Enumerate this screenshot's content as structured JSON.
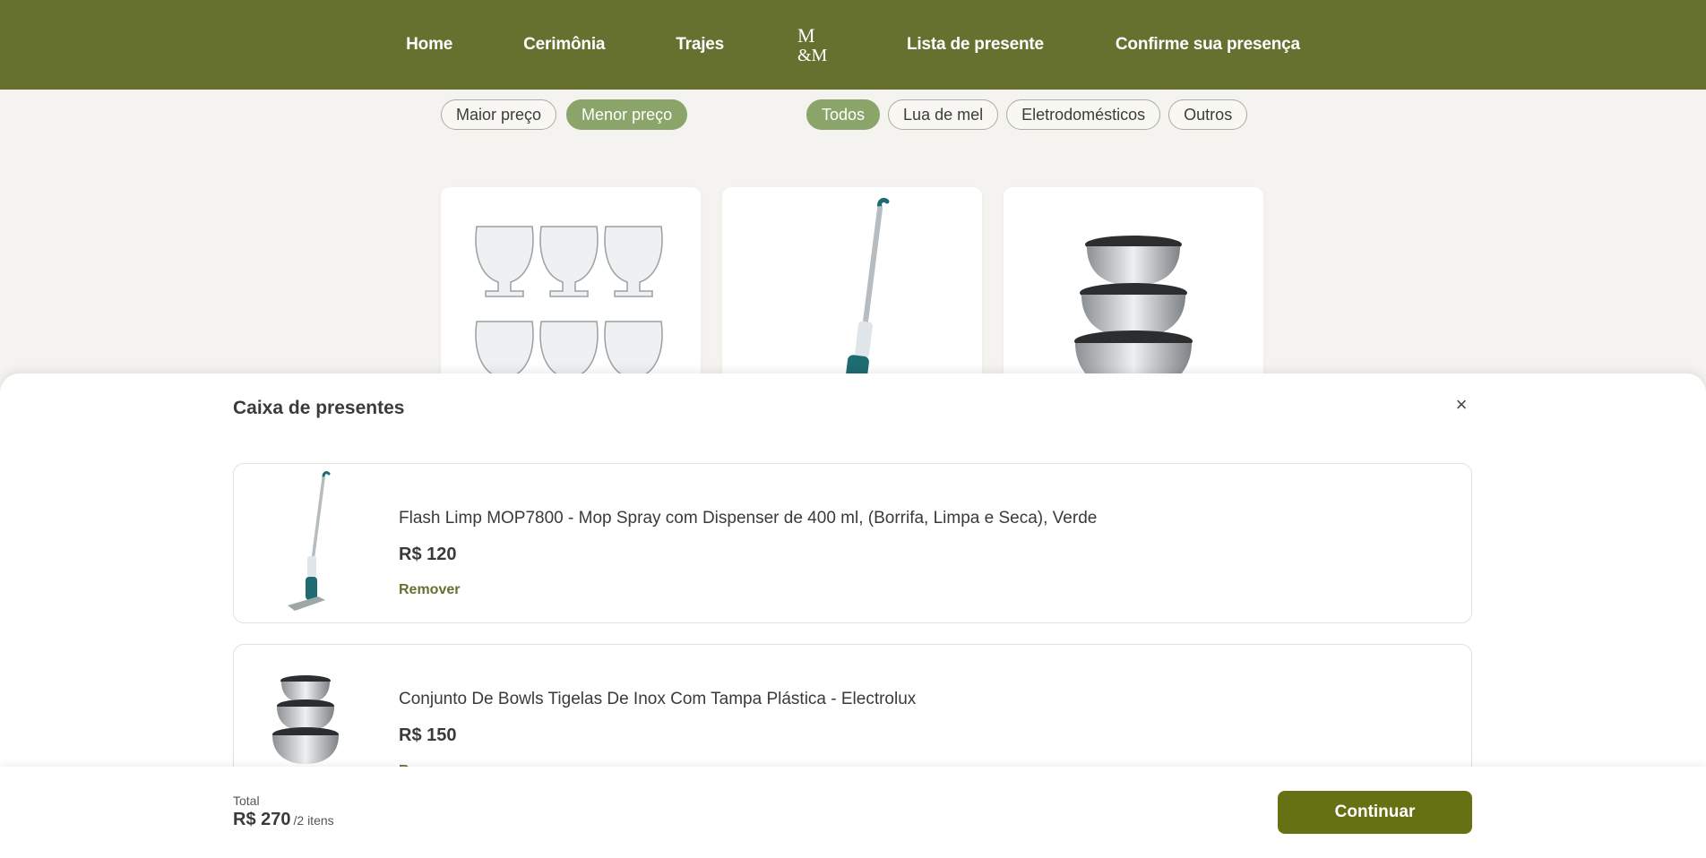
{
  "nav": {
    "home": "Home",
    "ceremony": "Cerimônia",
    "attire": "Trajes",
    "logo_text": "M&M",
    "gift_list": "Lista de presente",
    "rsvp": "Confirme sua presença"
  },
  "sort_filters": [
    "Maior preço",
    "Menor preço"
  ],
  "sort_active": "Menor preço",
  "category_filters": [
    "Todos",
    "Lua de mel",
    "Eletrodomésticos",
    "Outros"
  ],
  "category_active": "Todos",
  "gift_box": {
    "title": "Caixa de presentes",
    "close_label": "×",
    "items": [
      {
        "name": "Flash Limp MOP7800 - Mop Spray com Dispenser de 400 ml, (Borrifa, Limpa e Seca), Verde",
        "price": "R$ 120",
        "remove": "Remover",
        "icon": "mop-image"
      },
      {
        "name": "Conjunto De Bowls Tigelas De Inox Com Tampa Plástica - Electrolux",
        "price": "R$ 150",
        "remove": "Remover",
        "icon": "bowls-image"
      }
    ]
  },
  "footer": {
    "total_label": "Total",
    "total_value": "R$ 270",
    "total_count": "/2 itens",
    "continue_label": "Continuar"
  },
  "colors": {
    "header": "#667130",
    "active_pill": "#8aa46a",
    "continue_button": "#667114",
    "remove_link": "#667130"
  }
}
